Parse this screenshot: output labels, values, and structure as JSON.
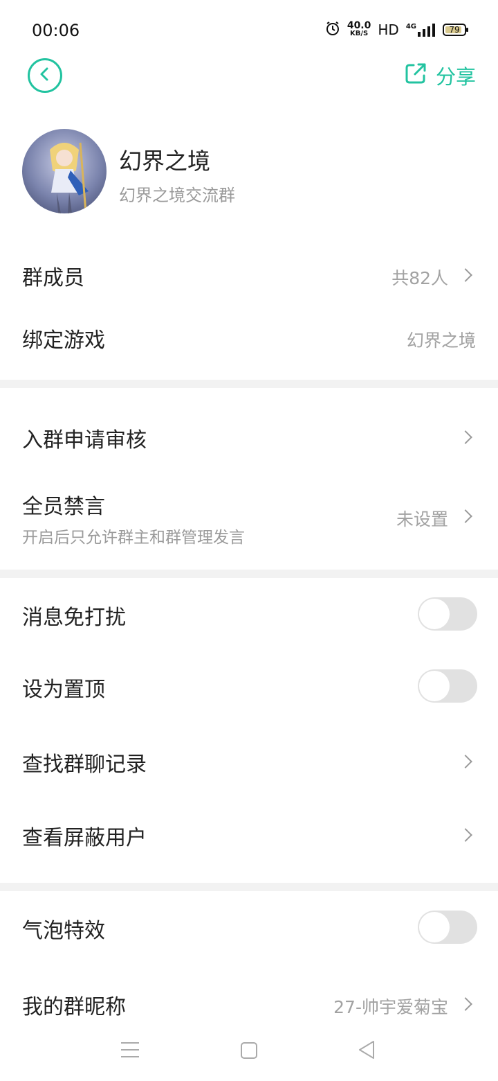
{
  "status_bar": {
    "time": "00:06",
    "net_speed_value": "40.0",
    "net_speed_unit": "KB/S",
    "hd": "HD",
    "network": "4G",
    "battery": "79"
  },
  "header": {
    "share_label": "分享"
  },
  "group": {
    "name": "幻界之境",
    "description": "幻界之境交流群"
  },
  "rows": {
    "members": {
      "label": "群成员",
      "value": "共82人"
    },
    "bind_game": {
      "label": "绑定游戏",
      "value": "幻界之境"
    },
    "join_review": {
      "label": "入群申请审核"
    },
    "mute_all": {
      "label": "全员禁言",
      "sub": "开启后只允许群主和群管理发言",
      "value": "未设置"
    },
    "dnd": {
      "label": "消息免打扰",
      "on": false
    },
    "pin_top": {
      "label": "设为置顶",
      "on": false
    },
    "search_history": {
      "label": "查找群聊记录"
    },
    "blocked_users": {
      "label": "查看屏蔽用户"
    },
    "bubble_effect": {
      "label": "气泡特效",
      "on": false
    },
    "my_nickname": {
      "label": "我的群昵称",
      "value": "27-帅宇爱菊宝"
    }
  },
  "colors": {
    "accent": "#22c3a0",
    "divider": "#f2f2f2",
    "toggle_off": "#e1e1e1",
    "secondary_text": "#9a9a9a"
  }
}
